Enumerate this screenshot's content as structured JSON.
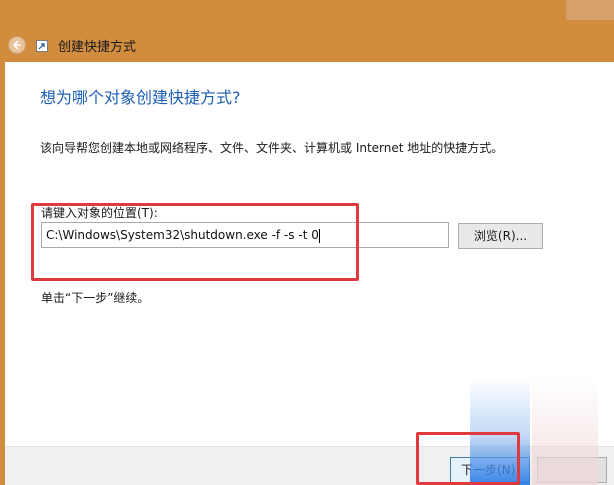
{
  "window": {
    "title": "创建快捷方式"
  },
  "page": {
    "heading": "想为哪个对象创建快捷方式?",
    "description": "该向导帮您创建本地或网络程序、文件、文件夹、计算机或 Internet 地址的快捷方式。",
    "location_label": "请键入对象的位置(T):",
    "location_value": "C:\\Windows\\System32\\shutdown.exe -f -s -t 0",
    "browse_label": "浏览(R)...",
    "hint": "单击“下一步”继续。"
  },
  "footer": {
    "next_label": "下一步(N)"
  },
  "colors": {
    "heading": "#1d5fb3",
    "window_frame": "#d28c3e",
    "highlight_box": "#e0393e"
  },
  "icons": [
    "back-arrow-icon",
    "shortcut-icon"
  ]
}
